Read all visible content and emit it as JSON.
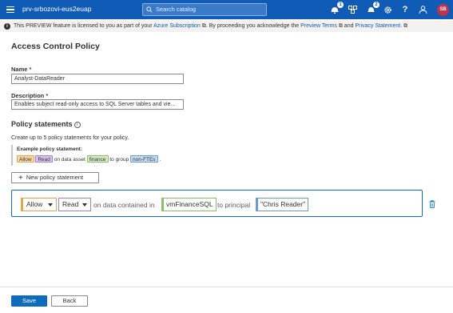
{
  "app": {
    "title": "prv-srbozovi-eus2euap",
    "search_placeholder": "Search catalog",
    "notification_count": "1",
    "alerts_count": "2",
    "avatar_initials": "SB",
    "accent": "#0f5bb5"
  },
  "infobar": {
    "text1": "This PREVIEW feature is licensed to you as part of your ",
    "link1": "Azure Subscription",
    "text2": ". By proceeding you acknowledge the ",
    "link2": "Preview Terms",
    "text3": " and ",
    "link3": "Privacy Statement."
  },
  "page": {
    "title": "Access Control Policy"
  },
  "form": {
    "name_label": "Name",
    "name_value": "Analyst-DataReader",
    "description_label": "Description",
    "description_value": "Enables subject read-only access to SQL Server tables and vie..."
  },
  "policy": {
    "section_title": "Policy statements",
    "hint": "Create up to 5 policy statements for your policy.",
    "example_title": "Example policy statement:",
    "example": {
      "effect": "Allow",
      "action": "Read",
      "text_asset": "on data asset",
      "asset": "finance",
      "text_group": "to group",
      "group": "non-FTEs",
      "end": "."
    },
    "new_button": "New policy statement",
    "statement": {
      "effect": "Allow",
      "action": "Read",
      "text_asset": "on data contained in",
      "asset": "vmFinanceSQL",
      "text_principal": "to principal",
      "principal": "\"Chris Reader\""
    }
  },
  "footer": {
    "save": "Save",
    "back": "Back"
  }
}
